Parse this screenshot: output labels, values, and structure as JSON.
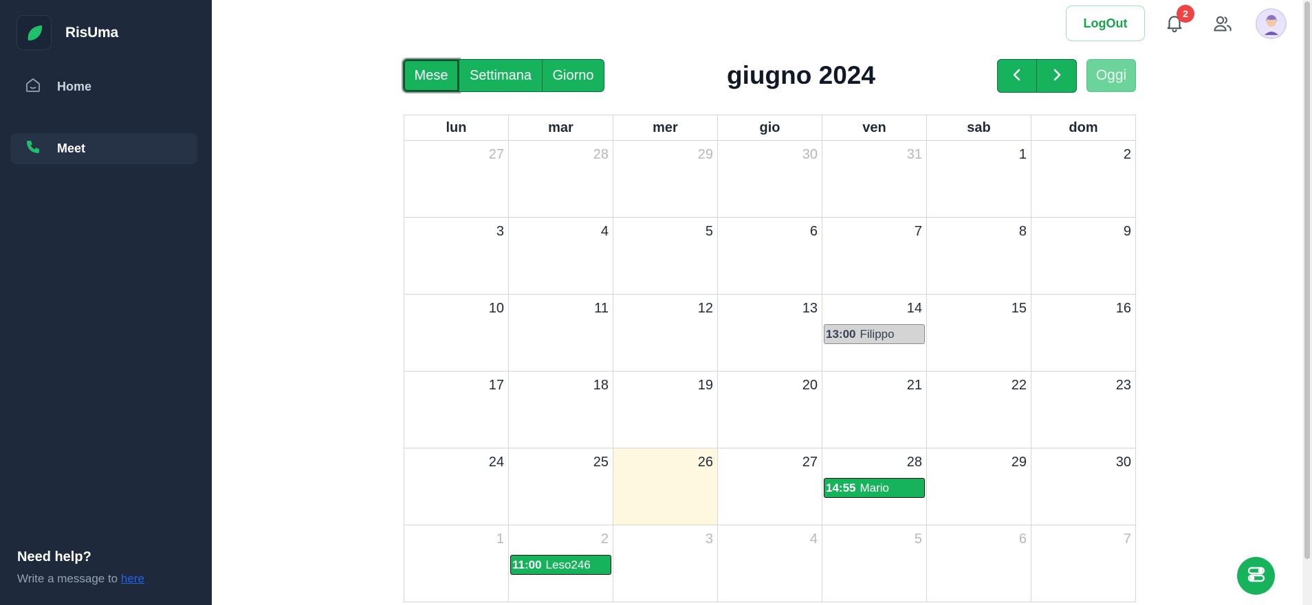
{
  "app": {
    "name": "RisUma",
    "accent_color": "#16b35c",
    "sidebar_color": "#1e293b"
  },
  "sidebar": {
    "items": [
      {
        "label": "Home",
        "icon": "home-icon",
        "active": false
      },
      {
        "label": "Meet",
        "icon": "phone-icon",
        "active": true
      }
    ],
    "help": {
      "title": "Need help?",
      "text": "Write a message to",
      "link_label": "here"
    }
  },
  "header": {
    "logout_label": "LogOut",
    "notifications_count": "2",
    "icons": [
      "bell-icon",
      "users-icon",
      "avatar"
    ]
  },
  "calendar": {
    "views": [
      "Mese",
      "Settimana",
      "Giorno"
    ],
    "active_view": "Mese",
    "title": "giugno 2024",
    "today_label": "Oggi",
    "prev_icon": "chevron-left-icon",
    "next_icon": "chevron-right-icon",
    "weekdays": [
      "lun",
      "mar",
      "mer",
      "gio",
      "ven",
      "sab",
      "dom"
    ],
    "weeks": [
      [
        {
          "d": "27",
          "other": true
        },
        {
          "d": "28",
          "other": true
        },
        {
          "d": "29",
          "other": true
        },
        {
          "d": "30",
          "other": true
        },
        {
          "d": "31",
          "other": true
        },
        {
          "d": "1"
        },
        {
          "d": "2"
        }
      ],
      [
        {
          "d": "3"
        },
        {
          "d": "4"
        },
        {
          "d": "5"
        },
        {
          "d": "6"
        },
        {
          "d": "7"
        },
        {
          "d": "8"
        },
        {
          "d": "9"
        }
      ],
      [
        {
          "d": "10"
        },
        {
          "d": "11"
        },
        {
          "d": "12"
        },
        {
          "d": "13"
        },
        {
          "d": "14",
          "event": {
            "time": "13:00",
            "title": "Filippo",
            "style": "gray"
          }
        },
        {
          "d": "15"
        },
        {
          "d": "16"
        }
      ],
      [
        {
          "d": "17"
        },
        {
          "d": "18"
        },
        {
          "d": "19"
        },
        {
          "d": "20"
        },
        {
          "d": "21"
        },
        {
          "d": "22"
        },
        {
          "d": "23"
        }
      ],
      [
        {
          "d": "24"
        },
        {
          "d": "25"
        },
        {
          "d": "26",
          "today": true
        },
        {
          "d": "27"
        },
        {
          "d": "28",
          "event": {
            "time": "14:55",
            "title": "Mario",
            "style": "green"
          }
        },
        {
          "d": "29"
        },
        {
          "d": "30"
        }
      ],
      [
        {
          "d": "1",
          "other": true
        },
        {
          "d": "2",
          "other": true,
          "event": {
            "time": "11:00",
            "title": "Leso246",
            "style": "green"
          }
        },
        {
          "d": "3",
          "other": true
        },
        {
          "d": "4",
          "other": true
        },
        {
          "d": "5",
          "other": true
        },
        {
          "d": "6",
          "other": true
        },
        {
          "d": "7",
          "other": true
        }
      ]
    ]
  }
}
